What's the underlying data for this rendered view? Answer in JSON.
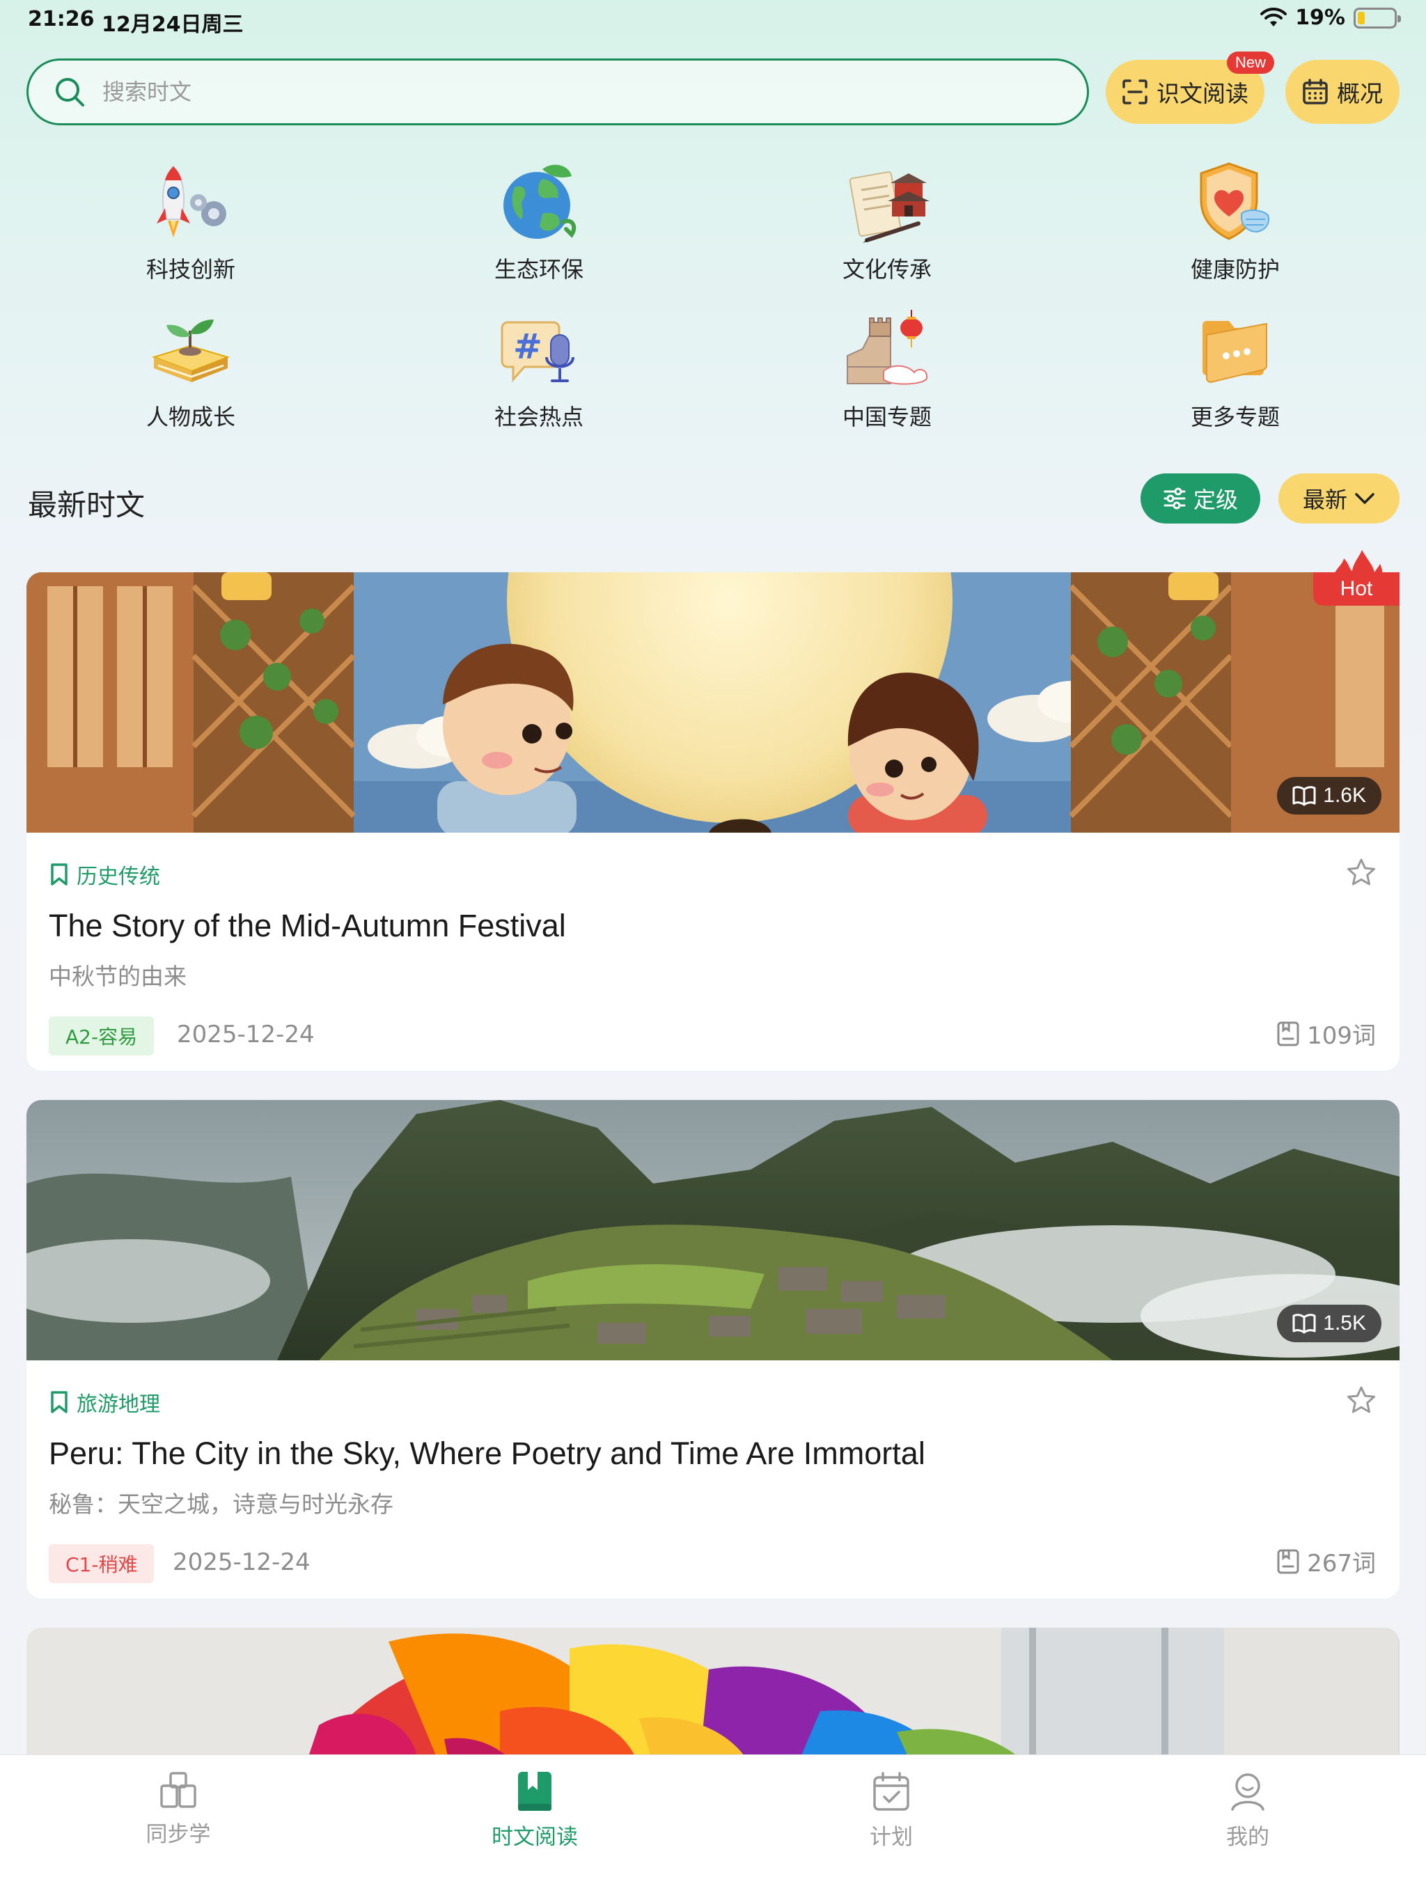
{
  "status_bar": {
    "time": "21:26",
    "date": "12月24日周三",
    "battery_pct": "19%",
    "battery_level": 0.19
  },
  "search": {
    "placeholder": "搜索时文"
  },
  "header_buttons": {
    "recognize_label": "识文阅读",
    "new_badge": "New",
    "overview_label": "概况"
  },
  "categories": [
    {
      "label": "科技创新",
      "icon": "rocket-icon"
    },
    {
      "label": "生态环保",
      "icon": "globe-icon"
    },
    {
      "label": "文化传承",
      "icon": "scroll-icon"
    },
    {
      "label": "健康防护",
      "icon": "shield-heart-icon"
    },
    {
      "label": "人物成长",
      "icon": "book-sprout-icon"
    },
    {
      "label": "社会热点",
      "icon": "hashtag-mic-icon"
    },
    {
      "label": "中国专题",
      "icon": "great-wall-icon"
    },
    {
      "label": "更多专题",
      "icon": "folder-icon"
    }
  ],
  "section": {
    "title": "最新时文",
    "filter_label": "定级",
    "sort_label": "最新"
  },
  "articles": [
    {
      "category": "历史传统",
      "title": "The Story of the Mid-Autumn Festival",
      "subtitle": "中秋节的由来",
      "level": "A2-容易",
      "date": "2025-12-24",
      "words": "109词",
      "reads": "1.6K",
      "hot": "Hot"
    },
    {
      "category": "旅游地理",
      "title": "Peru: The City in the Sky, Where Poetry and Time Are Immortal",
      "subtitle": "秘鲁：天空之城，诗意与时光永存",
      "level": "C1-稍难",
      "date": "2025-12-24",
      "words": "267词",
      "reads": "1.5K"
    }
  ],
  "tabs": [
    {
      "label": "同步学",
      "icon": "book-stack-icon",
      "active": false
    },
    {
      "label": "时文阅读",
      "icon": "bookmark-book-icon",
      "active": true
    },
    {
      "label": "计划",
      "icon": "calendar-check-icon",
      "active": false
    },
    {
      "label": "我的",
      "icon": "person-icon",
      "active": false
    }
  ],
  "colors": {
    "brand_green": "#1f9b6a",
    "accent_yellow": "#f9d66e",
    "hot_red": "#e53935"
  }
}
